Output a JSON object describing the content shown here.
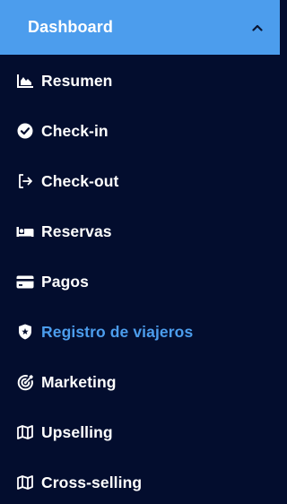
{
  "header": {
    "title": "Dashboard",
    "toggle_icon": "chevron-up-icon"
  },
  "colors": {
    "header_bg": "#4c9ded",
    "sidebar_bg": "#030d2e",
    "text": "#ffffff",
    "active_text": "#4c9ded"
  },
  "menu": {
    "items": [
      {
        "label": "Resumen",
        "icon": "area-chart-icon",
        "active": false
      },
      {
        "label": "Check-in",
        "icon": "check-circle-icon",
        "active": false
      },
      {
        "label": "Check-out",
        "icon": "sign-out-icon",
        "active": false
      },
      {
        "label": "Reservas",
        "icon": "bed-icon",
        "active": false
      },
      {
        "label": "Pagos",
        "icon": "credit-card-icon",
        "active": false
      },
      {
        "label": "Registro de viajeros",
        "icon": "police-badge-icon",
        "active": true
      },
      {
        "label": "Marketing",
        "icon": "target-icon",
        "active": false
      },
      {
        "label": "Upselling",
        "icon": "map-icon",
        "active": false
      },
      {
        "label": "Cross-selling",
        "icon": "map-icon",
        "active": false
      }
    ]
  }
}
